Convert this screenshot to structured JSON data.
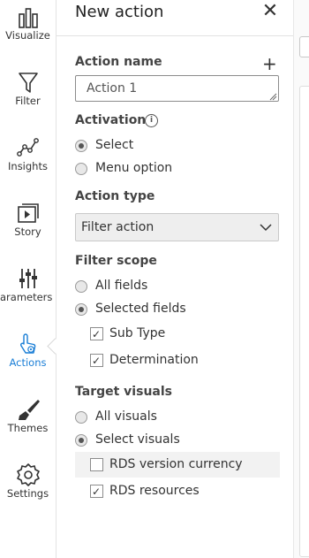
{
  "rail": {
    "items": [
      {
        "label": "Visualize",
        "icon": "bar-chart-icon"
      },
      {
        "label": "Filter",
        "icon": "funnel-icon"
      },
      {
        "label": "Insights",
        "icon": "insights-icon"
      },
      {
        "label": "Story",
        "icon": "story-icon"
      },
      {
        "label": "arameters",
        "icon": "sliders-icon"
      },
      {
        "label": "Actions",
        "icon": "pointer-icon"
      },
      {
        "label": "Themes",
        "icon": "brush-icon"
      },
      {
        "label": "Settings",
        "icon": "gear-icon"
      }
    ],
    "active_index": 5,
    "active_color": "#1a7ed6"
  },
  "panel": {
    "title": "New action",
    "action_name_label": "Action name",
    "add_symbol": "+",
    "action_name_value": "Action 1",
    "activation": {
      "label": "Activation",
      "info_symbol": "i",
      "options": [
        {
          "label": "Select",
          "checked": true
        },
        {
          "label": "Menu option",
          "checked": false
        }
      ]
    },
    "action_type": {
      "label": "Action type",
      "selected": "Filter action"
    },
    "filter_scope": {
      "label": "Filter scope",
      "options": [
        {
          "label": "All fields",
          "checked": false
        },
        {
          "label": "Selected fields",
          "checked": true
        }
      ],
      "fields": [
        {
          "label": "Sub Type",
          "checked": true
        },
        {
          "label": "Determination",
          "checked": true
        }
      ]
    },
    "target_visuals": {
      "label": "Target visuals",
      "options": [
        {
          "label": "All visuals",
          "checked": false
        },
        {
          "label": "Select visuals",
          "checked": true
        }
      ],
      "visuals": [
        {
          "label": "RDS version currency",
          "checked": false
        },
        {
          "label": "RDS resources",
          "checked": true
        }
      ]
    }
  }
}
